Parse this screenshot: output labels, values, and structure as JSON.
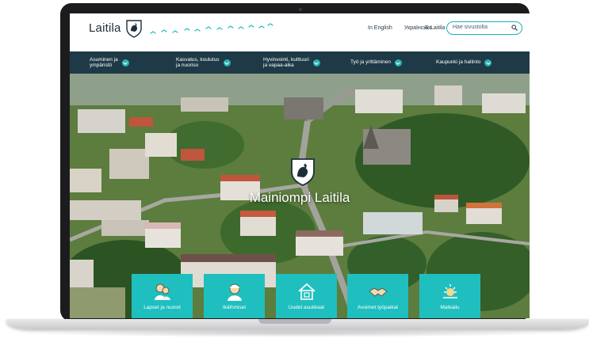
{
  "header": {
    "logo_text": "Laitila",
    "languages": [
      "In English",
      "Українська",
      "E-Laitila"
    ],
    "search_placeholder": "Hae sivustolta"
  },
  "nav": {
    "items": [
      {
        "line1": "Asuminen ja",
        "line2": "ympäristö"
      },
      {
        "line1": "Kasvatus, koulutus",
        "line2": "ja nuoriso"
      },
      {
        "line1": "Hyvinvointi, kulttuuri",
        "line2": "ja vapaa-aika"
      },
      {
        "line1": "Työ ja yrittäminen",
        "line2": ""
      },
      {
        "line1": "Kaupunki ja hallinto",
        "line2": ""
      }
    ]
  },
  "hero": {
    "title": "Mainiompi Laitila"
  },
  "tiles": [
    {
      "label": "Lapset ja nuoret",
      "icon": "children-icon"
    },
    {
      "label": "Ikäihmiset",
      "icon": "elderly-icon"
    },
    {
      "label": "Uudet asukkaat",
      "icon": "house-icon"
    },
    {
      "label": "Avoimet työpaikat",
      "icon": "handshake-icon"
    },
    {
      "label": "Matkailu",
      "icon": "sun-icon"
    }
  ],
  "colors": {
    "nav_bg": "#1f3a47",
    "accent_teal": "#1fbfbf",
    "search_border": "#18b5b9"
  }
}
